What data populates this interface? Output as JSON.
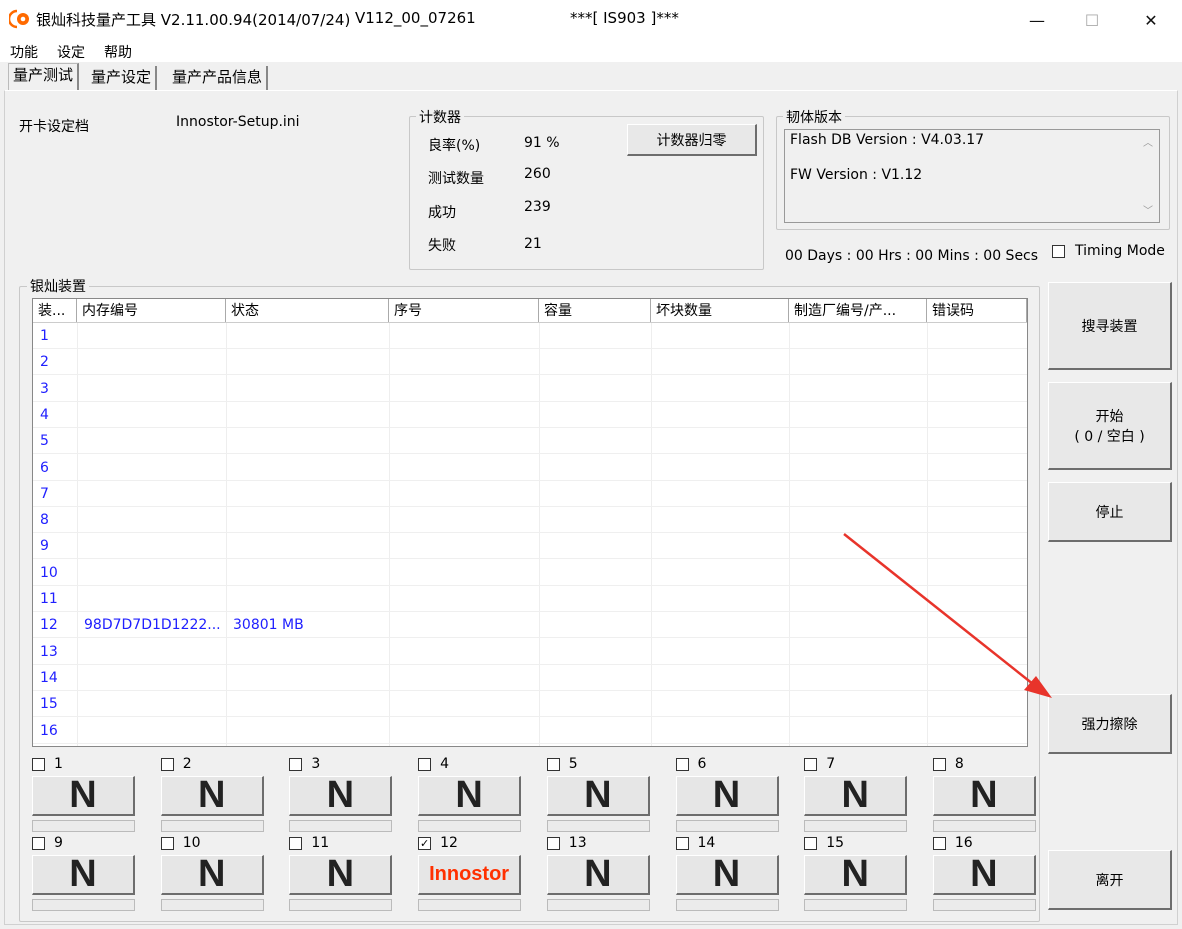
{
  "window": {
    "title": "银灿科技量产工具 V2.11.00.94(2014/07/24)",
    "version": "V112_00_07261",
    "chip": "***[ IS903 ]***",
    "minimize_glyph": "—",
    "maximize_glyph": "☐",
    "close_glyph": "✕"
  },
  "menu": [
    "功能",
    "设定",
    "帮助"
  ],
  "tabs": [
    "量产测试",
    "量产设定",
    "量产产品信息"
  ],
  "config": {
    "label": "开卡设定档",
    "file": "Innostor-Setup.ini"
  },
  "counter": {
    "group_label": "计数器",
    "reset_button": "计数器归零",
    "rows": [
      {
        "label": "良率(%)",
        "value": "91 %"
      },
      {
        "label": "测试数量",
        "value": "260"
      },
      {
        "label": "成功",
        "value": "239"
      },
      {
        "label": "失败",
        "value": "21"
      }
    ]
  },
  "firmware": {
    "group_label": "韧体版本",
    "flash_db": "Flash DB Version :  V4.03.17",
    "fw": "FW Version :   V1.12"
  },
  "timer": "00 Days : 00 Hrs : 00 Mins : 00 Secs",
  "timing_mode": {
    "label": "Timing Mode",
    "checked": false
  },
  "devices": {
    "group_label": "银灿装置",
    "columns": [
      "装...",
      "内存编号",
      "状态",
      "序号",
      "容量",
      "坏块数量",
      "制造厂编号/产...",
      "错误码"
    ],
    "rows": [
      [
        "1",
        "",
        "",
        "",
        "",
        "",
        "",
        ""
      ],
      [
        "2",
        "",
        "",
        "",
        "",
        "",
        "",
        ""
      ],
      [
        "3",
        "",
        "",
        "",
        "",
        "",
        "",
        ""
      ],
      [
        "4",
        "",
        "",
        "",
        "",
        "",
        "",
        ""
      ],
      [
        "5",
        "",
        "",
        "",
        "",
        "",
        "",
        ""
      ],
      [
        "6",
        "",
        "",
        "",
        "",
        "",
        "",
        ""
      ],
      [
        "7",
        "",
        "",
        "",
        "",
        "",
        "",
        ""
      ],
      [
        "8",
        "",
        "",
        "",
        "",
        "",
        "",
        ""
      ],
      [
        "9",
        "",
        "",
        "",
        "",
        "",
        "",
        ""
      ],
      [
        "10",
        "",
        "",
        "",
        "",
        "",
        "",
        ""
      ],
      [
        "11",
        "",
        "",
        "",
        "",
        "",
        "",
        ""
      ],
      [
        "12",
        "98D7D7D1D1222...",
        "30801 MB",
        "",
        "",
        "",
        "",
        ""
      ],
      [
        "13",
        "",
        "",
        "",
        "",
        "",
        "",
        ""
      ],
      [
        "14",
        "",
        "",
        "",
        "",
        "",
        "",
        ""
      ],
      [
        "15",
        "",
        "",
        "",
        "",
        "",
        "",
        ""
      ],
      [
        "16",
        "",
        "",
        "",
        "",
        "",
        "",
        ""
      ]
    ]
  },
  "slots": [
    {
      "num": "1",
      "checked": false,
      "label": "N"
    },
    {
      "num": "2",
      "checked": false,
      "label": "N"
    },
    {
      "num": "3",
      "checked": false,
      "label": "N"
    },
    {
      "num": "4",
      "checked": false,
      "label": "N"
    },
    {
      "num": "5",
      "checked": false,
      "label": "N"
    },
    {
      "num": "6",
      "checked": false,
      "label": "N"
    },
    {
      "num": "7",
      "checked": false,
      "label": "N"
    },
    {
      "num": "8",
      "checked": false,
      "label": "N"
    },
    {
      "num": "9",
      "checked": false,
      "label": "N"
    },
    {
      "num": "10",
      "checked": false,
      "label": "N"
    },
    {
      "num": "11",
      "checked": false,
      "label": "N"
    },
    {
      "num": "12",
      "checked": true,
      "label": "Innostor"
    },
    {
      "num": "13",
      "checked": false,
      "label": "N"
    },
    {
      "num": "14",
      "checked": false,
      "label": "N"
    },
    {
      "num": "15",
      "checked": false,
      "label": "N"
    },
    {
      "num": "16",
      "checked": false,
      "label": "N"
    }
  ],
  "side_buttons": {
    "search": "搜寻装置",
    "start_line1": "开始",
    "start_line2": "( 0 / 空白  )",
    "stop": "停止",
    "force_erase": "强力擦除",
    "exit": "离开"
  },
  "colors": {
    "list_text": "#2020ff",
    "brand_text": "#ff3000",
    "annotation_arrow": "#e8342b"
  }
}
